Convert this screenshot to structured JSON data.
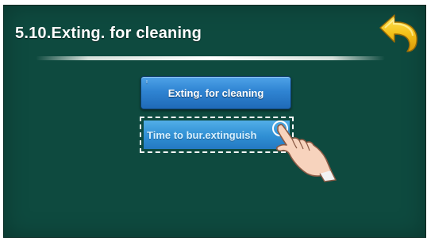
{
  "screen": {
    "title": "5.10.Exting. for cleaning",
    "back_icon": "back-arrow-icon",
    "background_color": "#0e4a3f",
    "accent_color": "#f4c21a"
  },
  "menu": {
    "items": [
      {
        "label": "Exting. for cleaning",
        "state": "normal"
      },
      {
        "label": "Time to bur.extinguish",
        "state": "selected"
      }
    ]
  },
  "hint": {
    "icon": "pointing-hand-icon"
  }
}
